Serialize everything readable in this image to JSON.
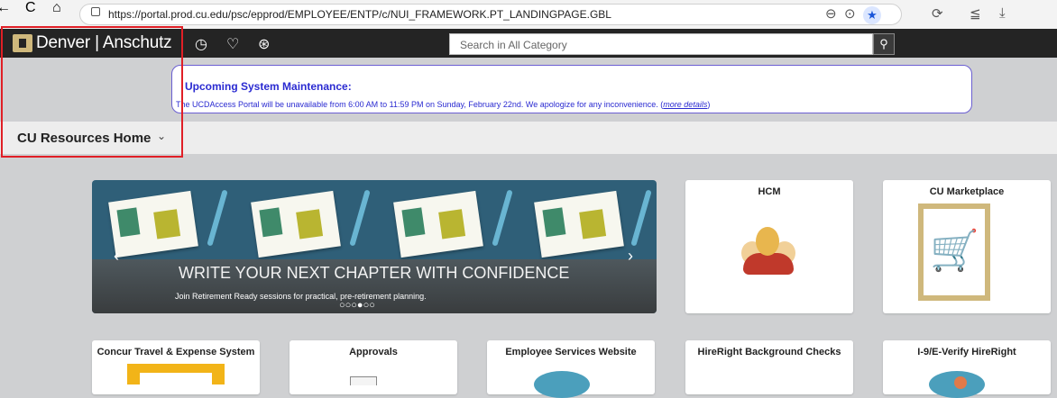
{
  "browser": {
    "url": "https://portal.prod.cu.edu/psc/epprod/EMPLOYEE/ENTP/c/NUI_FRAMEWORK.PT_LANDINGPAGE.GBL",
    "back": "←",
    "reload": "C",
    "home": "⌂",
    "zoom": "⊖",
    "more": "⊙",
    "star": "★",
    "extensions": "⟳",
    "favorites": "≦",
    "downloads": "⤓"
  },
  "header": {
    "brand": "Denver | Anschutz",
    "recent_icon": "◷",
    "favorites_icon": "♡",
    "accessibility_icon": "⊛",
    "search_placeholder": "Search in All Category",
    "search_icon": "⚲"
  },
  "notice": {
    "title": "Upcoming System Maintenance:",
    "body": "The UCDAccess Portal will be unavailable from 6:00 AM to 11:59 PM on Sunday, February 22nd. We apologize for any inconvenience. (",
    "link": "more details",
    "body_end": ")"
  },
  "page": {
    "title": "CU Resources Home",
    "chevron": "⌄"
  },
  "carousel": {
    "headline": "WRITE YOUR NEXT CHAPTER WITH CONFIDENCE",
    "subtext": "Join Retirement Ready sessions for practical, pre-retirement planning.",
    "prev": "‹",
    "next": "›",
    "dots": "○○○●○○"
  },
  "tiles": [
    {
      "title": "HCM"
    },
    {
      "title": "CU Marketplace"
    },
    {
      "title": "Concur Travel & Expense System"
    },
    {
      "title": "Approvals"
    },
    {
      "title": "Employee Services Website"
    },
    {
      "title": "HireRight Background Checks"
    },
    {
      "title": "I-9/E-Verify HireRight"
    }
  ],
  "colors": {
    "header_bg": "#242424",
    "cu_gold": "#cfb87c",
    "notice_text": "#2a2ad1",
    "highlight_box": "#e01f26"
  }
}
